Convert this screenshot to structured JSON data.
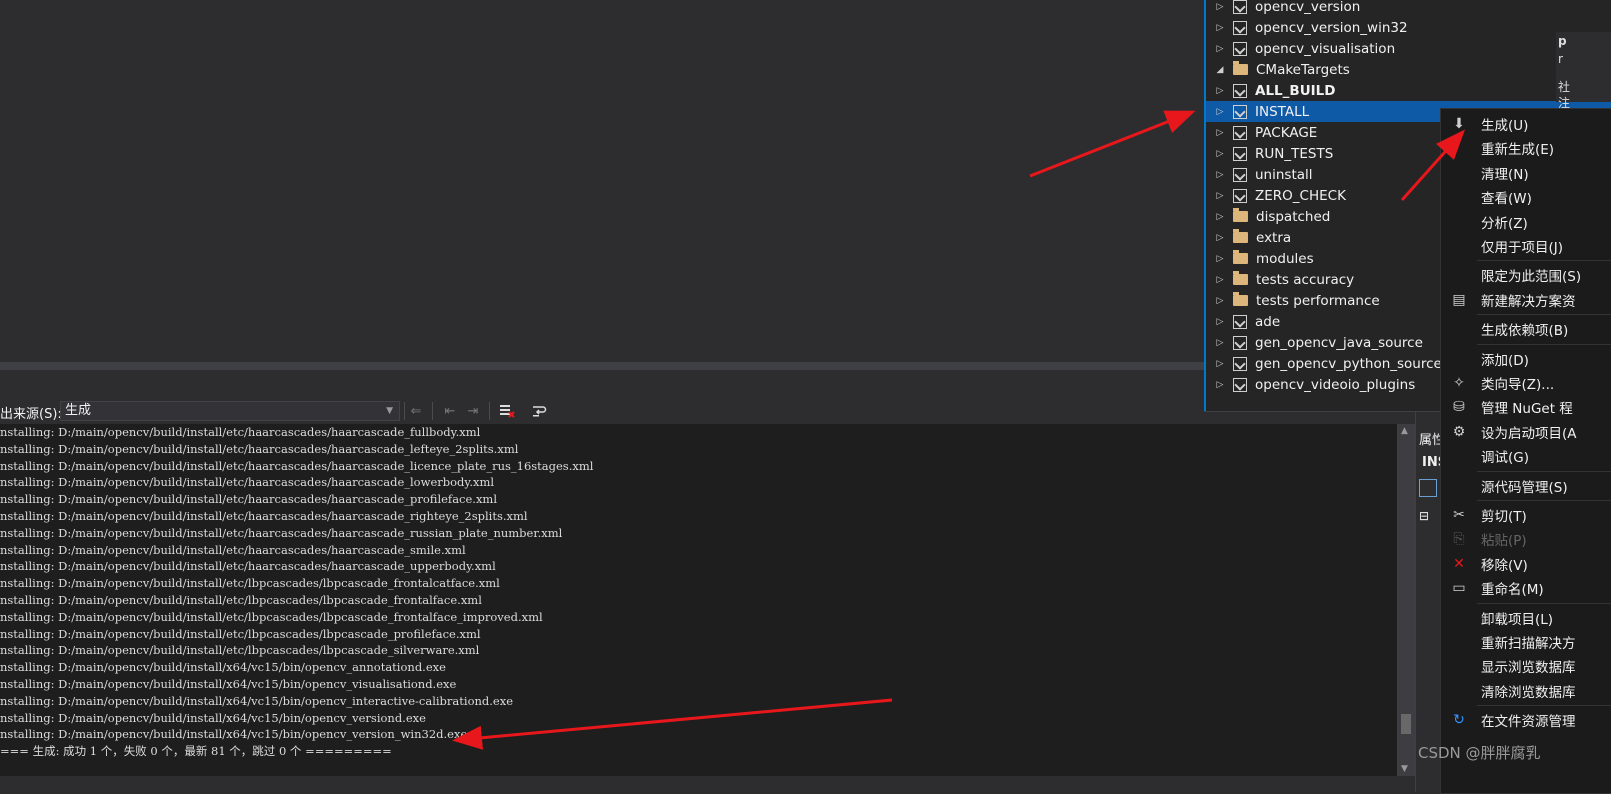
{
  "solution_explorer": {
    "items": [
      {
        "label": "opencv_version",
        "type": "project",
        "indent": 1,
        "expand": "collapsed"
      },
      {
        "label": "opencv_version_win32",
        "type": "project",
        "indent": 1,
        "expand": "collapsed"
      },
      {
        "label": "opencv_visualisation",
        "type": "project",
        "indent": 1,
        "expand": "collapsed"
      },
      {
        "label": "CMakeTargets",
        "type": "folder",
        "indent": 0,
        "expand": "expanded"
      },
      {
        "label": "ALL_BUILD",
        "type": "project",
        "indent": 1,
        "expand": "collapsed",
        "bold": true
      },
      {
        "label": "INSTALL",
        "type": "project",
        "indent": 1,
        "expand": "collapsed",
        "selected": true
      },
      {
        "label": "PACKAGE",
        "type": "project",
        "indent": 1,
        "expand": "collapsed"
      },
      {
        "label": "RUN_TESTS",
        "type": "project",
        "indent": 1,
        "expand": "collapsed"
      },
      {
        "label": "uninstall",
        "type": "project",
        "indent": 1,
        "expand": "collapsed"
      },
      {
        "label": "ZERO_CHECK",
        "type": "project",
        "indent": 1,
        "expand": "collapsed"
      },
      {
        "label": "dispatched",
        "type": "folder",
        "indent": 0,
        "expand": "collapsed"
      },
      {
        "label": "extra",
        "type": "folder",
        "indent": 0,
        "expand": "collapsed"
      },
      {
        "label": "modules",
        "type": "folder",
        "indent": 0,
        "expand": "collapsed"
      },
      {
        "label": "tests accuracy",
        "type": "folder",
        "indent": 0,
        "expand": "collapsed"
      },
      {
        "label": "tests performance",
        "type": "folder",
        "indent": 0,
        "expand": "collapsed"
      },
      {
        "label": "ade",
        "type": "project",
        "indent": 0,
        "expand": "collapsed"
      },
      {
        "label": "gen_opencv_java_source",
        "type": "project",
        "indent": 0,
        "expand": "collapsed"
      },
      {
        "label": "gen_opencv_python_source",
        "type": "project",
        "indent": 0,
        "expand": "collapsed"
      },
      {
        "label": "opencv_videoio_plugins",
        "type": "project",
        "indent": 0,
        "expand": "collapsed"
      }
    ]
  },
  "output": {
    "source_label": "出来源(S):",
    "source_value": "生成",
    "lines": [
      "nstalling: D:/main/opencv/build/install/etc/haarcascades/haarcascade_fullbody.xml",
      "nstalling: D:/main/opencv/build/install/etc/haarcascades/haarcascade_lefteye_2splits.xml",
      "nstalling: D:/main/opencv/build/install/etc/haarcascades/haarcascade_licence_plate_rus_16stages.xml",
      "nstalling: D:/main/opencv/build/install/etc/haarcascades/haarcascade_lowerbody.xml",
      "nstalling: D:/main/opencv/build/install/etc/haarcascades/haarcascade_profileface.xml",
      "nstalling: D:/main/opencv/build/install/etc/haarcascades/haarcascade_righteye_2splits.xml",
      "nstalling: D:/main/opencv/build/install/etc/haarcascades/haarcascade_russian_plate_number.xml",
      "nstalling: D:/main/opencv/build/install/etc/haarcascades/haarcascade_smile.xml",
      "nstalling: D:/main/opencv/build/install/etc/haarcascades/haarcascade_upperbody.xml",
      "nstalling: D:/main/opencv/build/install/etc/lbpcascades/lbpcascade_frontalcatface.xml",
      "nstalling: D:/main/opencv/build/install/etc/lbpcascades/lbpcascade_frontalface.xml",
      "nstalling: D:/main/opencv/build/install/etc/lbpcascades/lbpcascade_frontalface_improved.xml",
      "nstalling: D:/main/opencv/build/install/etc/lbpcascades/lbpcascade_profileface.xml",
      "nstalling: D:/main/opencv/build/install/etc/lbpcascades/lbpcascade_silverware.xml",
      "nstalling: D:/main/opencv/build/install/x64/vc15/bin/opencv_annotationd.exe",
      "nstalling: D:/main/opencv/build/install/x64/vc15/bin/opencv_visualisationd.exe",
      "nstalling: D:/main/opencv/build/install/x64/vc15/bin/opencv_interactive-calibrationd.exe",
      "nstalling: D:/main/opencv/build/install/x64/vc15/bin/opencv_versiond.exe",
      "nstalling: D:/main/opencv/build/install/x64/vc15/bin/opencv_version_win32d.exe",
      "=== 生成: 成功 1 个，失败 0 个，最新 81 个，跳过 0 个 ========="
    ]
  },
  "context_menu": {
    "items": [
      {
        "label": "生成(U)",
        "icon": "build-icon"
      },
      {
        "label": "重新生成(E)"
      },
      {
        "label": "清理(N)"
      },
      {
        "label": "查看(W)"
      },
      {
        "label": "分析(Z)"
      },
      {
        "label": "仅用于项目(J)"
      },
      {
        "sep": true
      },
      {
        "label": "限定为此范围(S)"
      },
      {
        "label": "新建解决方案资",
        "icon": "new-view-icon"
      },
      {
        "sep": true
      },
      {
        "label": "生成依赖项(B)"
      },
      {
        "sep": true
      },
      {
        "label": "添加(D)"
      },
      {
        "label": "类向导(Z)...",
        "icon": "class-wizard-icon"
      },
      {
        "label": "管理 NuGet 程",
        "icon": "nuget-icon"
      },
      {
        "label": "设为启动项目(A",
        "icon": "gear-icon"
      },
      {
        "label": "调试(G)"
      },
      {
        "sep": true
      },
      {
        "label": "源代码管理(S)"
      },
      {
        "sep": true
      },
      {
        "label": "剪切(T)",
        "icon": "cut-icon"
      },
      {
        "label": "粘贴(P)",
        "icon": "paste-icon",
        "disabled": true
      },
      {
        "label": "移除(V)",
        "icon": "remove-icon"
      },
      {
        "label": "重命名(M)",
        "icon": "rename-icon"
      },
      {
        "sep": true
      },
      {
        "label": "卸载项目(L)"
      },
      {
        "label": "重新扫描解决方"
      },
      {
        "label": "显示浏览数据库"
      },
      {
        "label": "清除浏览数据库"
      },
      {
        "sep": true
      },
      {
        "label": "在文件资源管理",
        "icon": "open-folder-icon"
      }
    ]
  },
  "properties": {
    "title_partial": "属性",
    "name_partial": "INS"
  },
  "right_strip": {
    "line1": "p",
    "line2": "r",
    "line3": "社",
    "line4": "注"
  },
  "watermark": "CSDN @胖胖腐乳",
  "colors": {
    "selection": "#0e5aa7",
    "accent": "#007acc",
    "arrow": "#e8171b"
  }
}
